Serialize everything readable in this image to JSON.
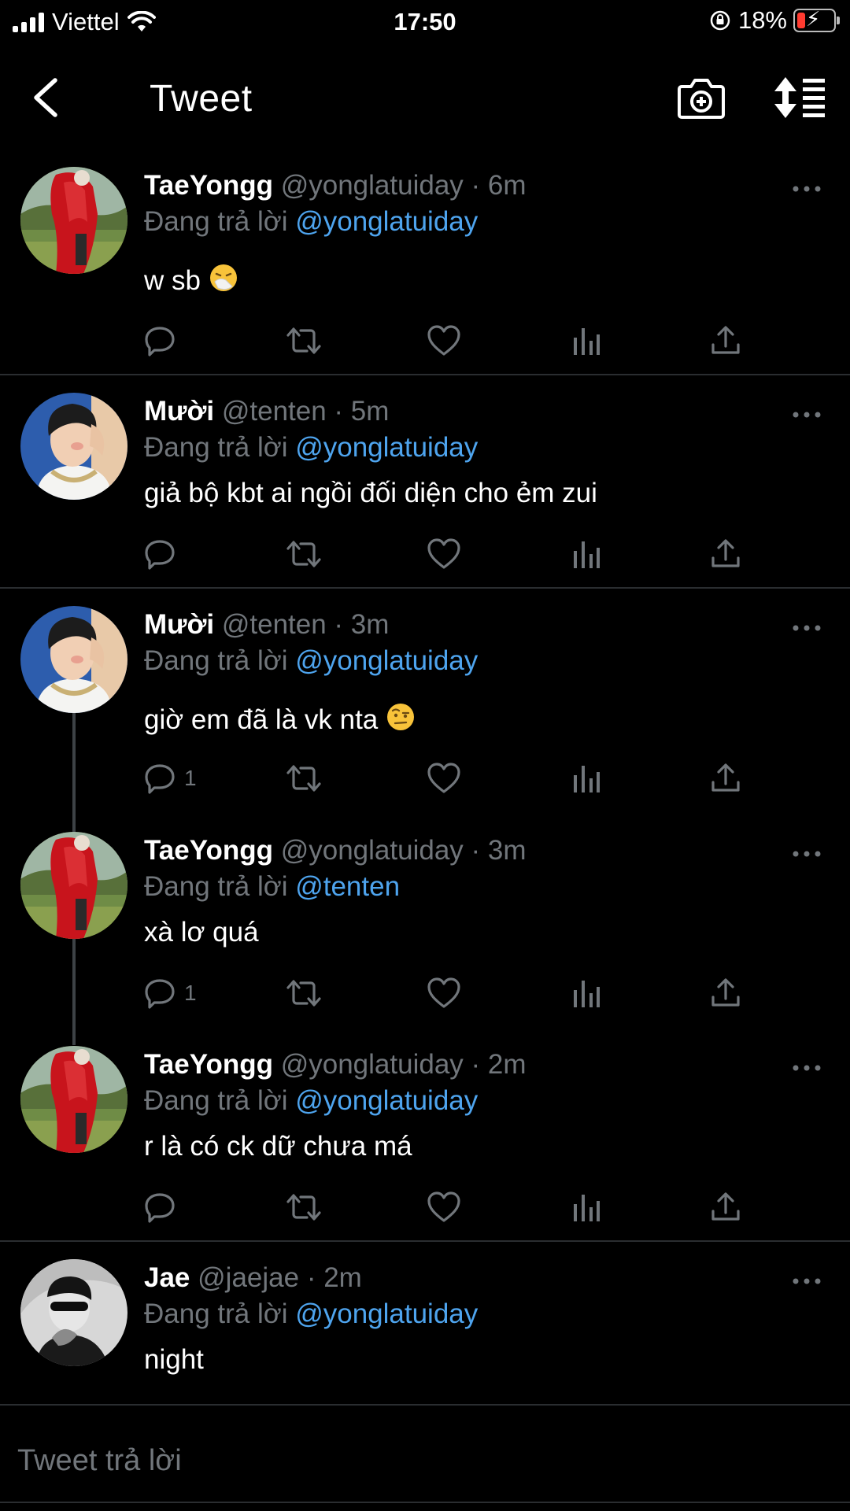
{
  "status_bar": {
    "carrier": "Viettel",
    "time": "17:50",
    "battery": "18%"
  },
  "nav": {
    "title": "Tweet"
  },
  "tweets": [
    {
      "name": "TaeYongg",
      "handle": "@yonglatuiday",
      "time": "· 6m",
      "replying_label": "Đang trả lời",
      "replying_to": "@yonglatuiday",
      "text": "w sb",
      "emoji": "sneezing",
      "reply_count": ""
    },
    {
      "name": "Mười",
      "handle": "@tenten",
      "time": "· 5m",
      "replying_label": "Đang trả lời",
      "replying_to": "@yonglatuiday",
      "text": "giả bộ kbt ai ngồi đối diện cho ẻm zui",
      "reply_count": ""
    },
    {
      "name": "Mười",
      "handle": "@tenten",
      "time": "· 3m",
      "replying_label": "Đang trả lời",
      "replying_to": "@yonglatuiday",
      "text": "giờ em đã là vk nta",
      "emoji": "raised-eyebrow",
      "reply_count": "1"
    },
    {
      "name": "TaeYongg",
      "handle": "@yonglatuiday",
      "time": "· 3m",
      "replying_label": "Đang trả lời",
      "replying_to": "@tenten",
      "text": "xà lơ quá",
      "reply_count": "1"
    },
    {
      "name": "TaeYongg",
      "handle": "@yonglatuiday",
      "time": "· 2m",
      "replying_label": "Đang trả lời",
      "replying_to": "@yonglatuiday",
      "text": "r là có ck dữ chưa má",
      "reply_count": ""
    },
    {
      "name": "Jae",
      "handle": "@jaejae",
      "time": "· 2m",
      "replying_label": "Đang trả lời",
      "replying_to": "@yonglatuiday",
      "text": "night",
      "reply_count": ""
    }
  ],
  "reply": {
    "placeholder": "Tweet trả lời"
  },
  "colors": {
    "background": "#000000",
    "accent": "#4ea4ee",
    "secondary_text": "#71767b",
    "divider": "#2a2d30"
  },
  "icons": [
    "back-chevron-icon",
    "camera-plus-icon",
    "sort-icon",
    "reply-icon",
    "retweet-icon",
    "like-icon",
    "analytics-icon",
    "share-icon",
    "more-icon"
  ]
}
